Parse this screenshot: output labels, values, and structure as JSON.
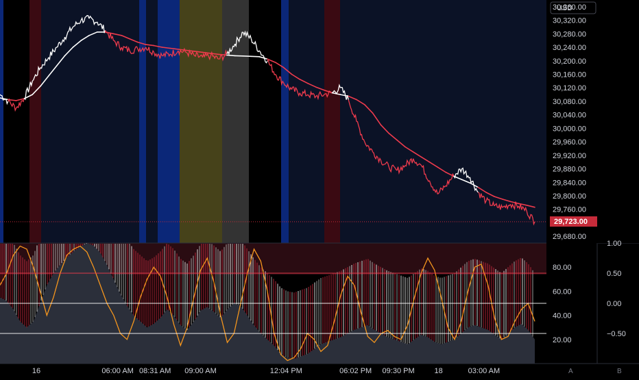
{
  "chart_data": [
    {
      "type": "line",
      "currency": "USD",
      "price_label": "29,723.00",
      "y_ticks": [
        "30,360.00",
        "30,320.00",
        "30,280.00",
        "30,240.00",
        "30,200.00",
        "30,160.00",
        "30,120.00",
        "30,080.00",
        "30,040.00",
        "30,000.00",
        "29,960.00",
        "29,920.00",
        "29,880.00",
        "29,840.00",
        "29,800.00",
        "29,760.00",
        "29,680.00"
      ],
      "y_tick_values": [
        30360,
        30320,
        30280,
        30240,
        30200,
        30160,
        30120,
        30080,
        30040,
        30000,
        29960,
        29920,
        29880,
        29840,
        29800,
        29760,
        29680
      ],
      "ylim": [
        29660,
        30380
      ],
      "time_labels": [
        "16",
        "06:00 AM",
        "08:31 AM",
        "09:00 AM",
        "12:04 PM",
        "06:02 PM",
        "09:30 PM",
        "18",
        "03:00 AM"
      ],
      "series": [
        {
          "values": [
            30100,
            30080,
            30060,
            30090,
            30140,
            30180,
            30210,
            30240,
            30270,
            30300,
            30320,
            30325,
            30315,
            30290,
            30260,
            30240,
            30230,
            30235,
            30240,
            30225,
            30215,
            30220,
            30230,
            30225,
            30215,
            30210,
            30215,
            30205,
            30220,
            30250,
            30285,
            30265,
            30230,
            30200,
            30160,
            30135,
            30115,
            30105,
            30100,
            30095,
            30100,
            30105,
            30120,
            30085,
            30020,
            29960,
            29930,
            29905,
            29885,
            29875,
            29890,
            29910,
            29890,
            29845,
            29805,
            29830,
            29860,
            29880,
            29855,
            29810,
            29785,
            29770,
            29765,
            29775,
            29770,
            29755,
            29723
          ],
          "baseline": [
            30090,
            30085,
            30082,
            30088,
            30100,
            30125,
            30155,
            30185,
            30215,
            30240,
            30260,
            30275,
            30285,
            30285,
            30280,
            30275,
            30265,
            30255,
            30248,
            30245,
            30240,
            30237,
            30234,
            30231,
            30228,
            30225,
            30222,
            30219,
            30217,
            30215,
            30214,
            30213,
            30212,
            30205,
            30195,
            30180,
            30160,
            30145,
            30133,
            30122,
            30113,
            30105,
            30100,
            30095,
            30085,
            30070,
            30045,
            30010,
            29985,
            29965,
            29945,
            29930,
            29915,
            29900,
            29885,
            29870,
            29858,
            29848,
            29838,
            29825,
            29810,
            29798,
            29790,
            29783,
            29777,
            29772,
            29766
          ]
        }
      ]
    },
    {
      "type": "area",
      "ylim": [
        0,
        100
      ],
      "left_ticks": [
        "80.00",
        "60.00",
        "40.00",
        "20.00"
      ],
      "left_tick_values": [
        80,
        60,
        40,
        20
      ],
      "right_ticks": [
        "1.00",
        "0.50",
        "0.00",
        "−0.50"
      ],
      "right_tick_values": [
        1.0,
        0.5,
        0.0,
        -0.5
      ],
      "right_ylim": [
        -1.0,
        1.0
      ],
      "zones": [
        75,
        50,
        25
      ],
      "series": [
        {
          "values": [
            55,
            52,
            45,
            35,
            30,
            35,
            50,
            65,
            75,
            82,
            88,
            93,
            97,
            100,
            98,
            92,
            82,
            70,
            58,
            48,
            40,
            35,
            30,
            33,
            38,
            45,
            40,
            32,
            28,
            35,
            44,
            47,
            43,
            38,
            45,
            50,
            48,
            40,
            32,
            25,
            20,
            15,
            8,
            5,
            4,
            6,
            8,
            12,
            16,
            18,
            20,
            22,
            25,
            28,
            30,
            32,
            28,
            25,
            22,
            20,
            18,
            16,
            20,
            24,
            22,
            18,
            16,
            18,
            20,
            25,
            30,
            32,
            30,
            28,
            24,
            20,
            25,
            30,
            33,
            28,
            20
          ]
        },
        {
          "values": [
            0.3,
            0.5,
            0.8,
            0.95,
            0.9,
            0.6,
            0.2,
            -0.2,
            0.1,
            0.5,
            0.8,
            0.9,
            0.95,
            0.85,
            0.6,
            0.3,
            0.0,
            -0.2,
            -0.5,
            -0.6,
            -0.3,
            0.1,
            0.4,
            0.6,
            0.45,
            0.1,
            -0.35,
            -0.7,
            -0.4,
            0.1,
            0.55,
            0.75,
            0.35,
            -0.2,
            -0.65,
            -0.5,
            0.0,
            0.5,
            0.9,
            0.7,
            0.2,
            -0.5,
            -0.85,
            -0.95,
            -0.9,
            -0.75,
            -0.5,
            -0.6,
            -0.8,
            -0.7,
            -0.3,
            0.15,
            0.45,
            0.3,
            -0.15,
            -0.55,
            -0.65,
            -0.5,
            -0.45,
            -0.55,
            -0.6,
            -0.35,
            0.1,
            0.5,
            0.75,
            0.55,
            0.1,
            -0.4,
            -0.6,
            -0.3,
            0.2,
            0.6,
            0.65,
            0.3,
            -0.25,
            -0.6,
            -0.55,
            -0.3,
            -0.1,
            0.0,
            -0.3
          ]
        }
      ]
    }
  ],
  "colors": {
    "up": "#ffffff",
    "down": "#ef3b4d",
    "oscillator": "#f5961e",
    "price_badge": "#c62b3a",
    "bg_dark_red": "#3a0a12",
    "bg_blue": "#0b2778",
    "bg_olive": "#46421a",
    "bg_gray": "#333333",
    "bg_navy": "#0b1226"
  },
  "bottom_buttons": [
    "A",
    "B"
  ]
}
